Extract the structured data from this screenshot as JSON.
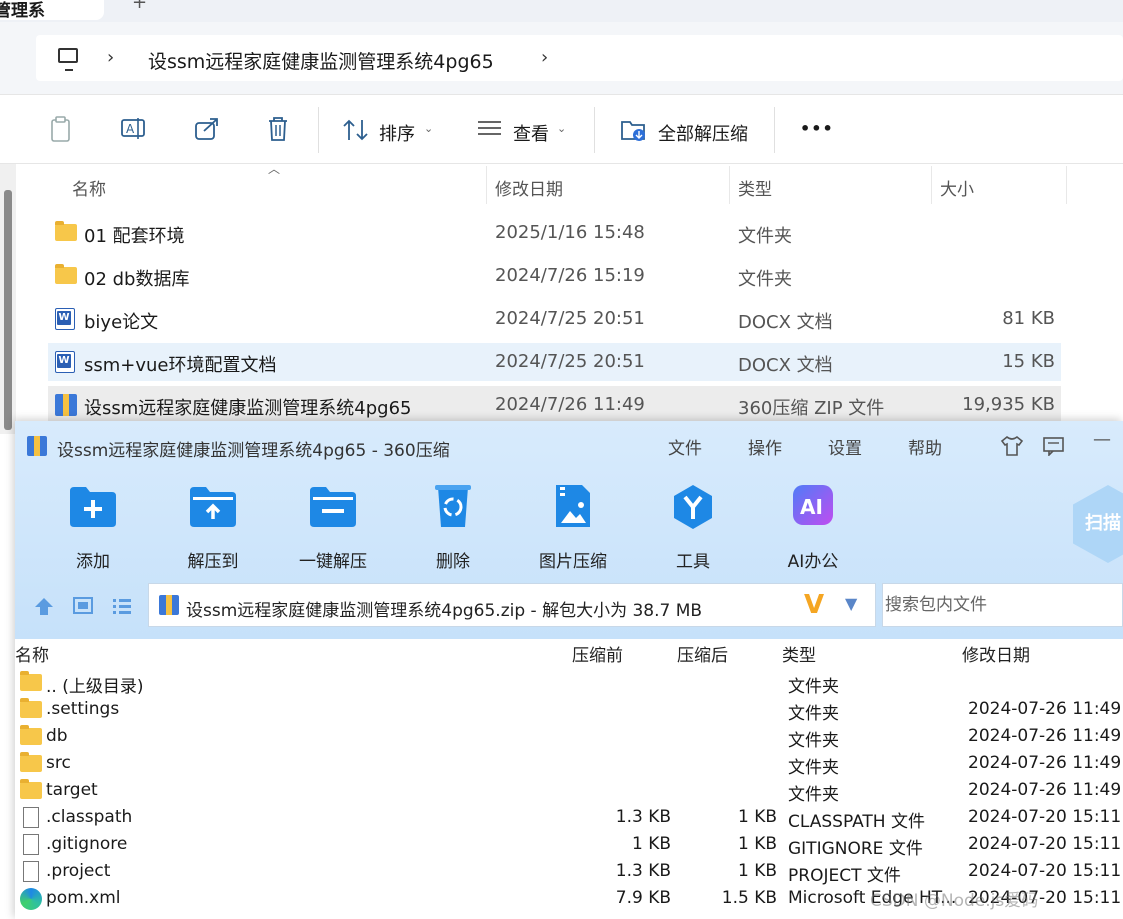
{
  "explorer": {
    "tab_title": "管理系",
    "tab_new": "+",
    "breadcrumb": {
      "chevron": "›",
      "folder": "设ssm远程家庭健康监测管理系统4pg65",
      "trail_chevron": "›"
    },
    "toolbar": {
      "sort_label": "排序",
      "view_label": "查看",
      "extract_all_label": "全部解压缩",
      "more_label": "•••"
    },
    "columns": {
      "name": "名称",
      "date": "修改日期",
      "type": "类型",
      "size": "大小"
    },
    "files": [
      {
        "icon": "folder-icon",
        "name": "01 配套环境",
        "date": "2025/1/16 15:48",
        "type": "文件夹",
        "size": ""
      },
      {
        "icon": "folder-icon",
        "name": "02 db数据库",
        "date": "2024/7/26 15:19",
        "type": "文件夹",
        "size": ""
      },
      {
        "icon": "word-doc-icon",
        "name": "biye论文",
        "date": "2024/7/25 20:51",
        "type": "DOCX 文档",
        "size": "81 KB"
      },
      {
        "icon": "word-doc-icon",
        "name": "ssm+vue环境配置文档",
        "date": "2024/7/25 20:51",
        "type": "DOCX 文档",
        "size": "15 KB"
      },
      {
        "icon": "zip-archive-icon",
        "name": "设ssm远程家庭健康监测管理系统4pg65",
        "date": "2024/7/26 11:49",
        "type": "360压缩 ZIP 文件",
        "size": "19,935 KB"
      }
    ]
  },
  "zipwin": {
    "title": "设ssm远程家庭健康监测管理系统4pg65 - 360压缩",
    "menu": [
      "文件",
      "操作",
      "设置",
      "帮助"
    ],
    "actions": [
      {
        "label": "添加",
        "icon": "add-folder-icon"
      },
      {
        "label": "解压到",
        "icon": "extract-to-icon"
      },
      {
        "label": "一键解压",
        "icon": "one-click-extract-icon"
      },
      {
        "label": "删除",
        "icon": "recycle-delete-icon"
      },
      {
        "label": "图片压缩",
        "icon": "image-compress-icon"
      },
      {
        "label": "工具",
        "icon": "tools-icon"
      },
      {
        "label": "AI办公",
        "icon": "ai-office-icon"
      }
    ],
    "scan_label": "扫描",
    "path_text": "设ssm远程家庭健康监测管理系统4pg65.zip - 解包大小为 38.7 MB",
    "search_placeholder": "搜索包内文件",
    "columns": {
      "name": "名称",
      "before": "压缩前",
      "after": "压缩后",
      "type": "类型",
      "date": "修改日期"
    },
    "rows": [
      {
        "icon": "folder-icon",
        "name": ".. (上级目录)",
        "before": "",
        "after": "",
        "type": "文件夹",
        "date": ""
      },
      {
        "icon": "folder-icon",
        "name": ".settings",
        "before": "",
        "after": "",
        "type": "文件夹",
        "date": "2024-07-26 11:49"
      },
      {
        "icon": "folder-icon",
        "name": "db",
        "before": "",
        "after": "",
        "type": "文件夹",
        "date": "2024-07-26 11:49"
      },
      {
        "icon": "folder-icon",
        "name": "src",
        "before": "",
        "after": "",
        "type": "文件夹",
        "date": "2024-07-26 11:49"
      },
      {
        "icon": "folder-icon",
        "name": "target",
        "before": "",
        "after": "",
        "type": "文件夹",
        "date": "2024-07-26 11:49"
      },
      {
        "icon": "file-icon",
        "name": ".classpath",
        "before": "1.3 KB",
        "after": "1 KB",
        "type": "CLASSPATH 文件",
        "date": "2024-07-20 15:11"
      },
      {
        "icon": "file-icon",
        "name": ".gitignore",
        "before": "1 KB",
        "after": "1 KB",
        "type": "GITIGNORE 文件",
        "date": "2024-07-20 15:11"
      },
      {
        "icon": "file-icon",
        "name": ".project",
        "before": "1.3 KB",
        "after": "1 KB",
        "type": "PROJECT 文件",
        "date": "2024-07-20 15:11"
      },
      {
        "icon": "edge-icon",
        "name": "pom.xml",
        "before": "7.9 KB",
        "after": "1.5 KB",
        "type": "Microsoft Edge HT...",
        "date": "2024-07-20 15:11"
      }
    ],
    "watermark": "CSDN @Node.js爱码"
  },
  "colors": {
    "accent": "#1e88e5",
    "zip_header": "#c6e1fa",
    "selection": "#e8f2fb",
    "folder": "#f7c74a"
  }
}
